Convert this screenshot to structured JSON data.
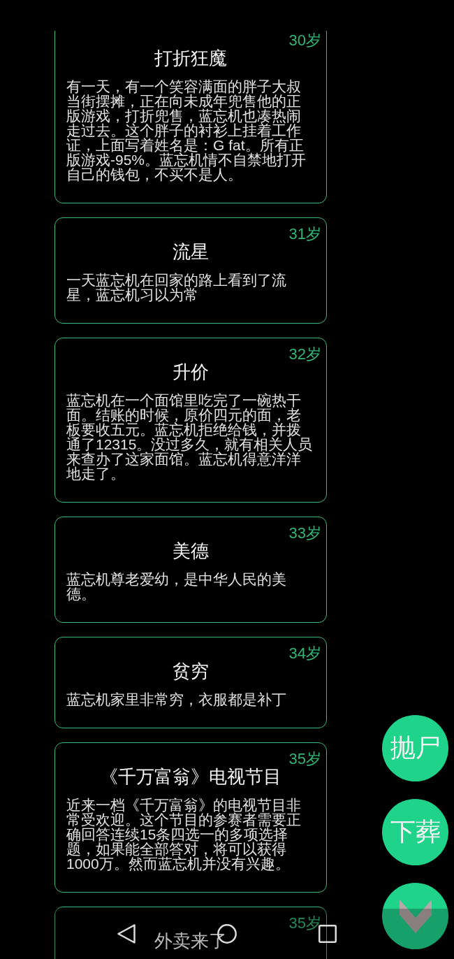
{
  "events": [
    {
      "age": "30岁",
      "title": "打折狂魔",
      "text": "有一天，有一个笑容满面的胖子大叔当街摆摊，正在向未成年兜售他的正版游戏，打折兜售，蓝忘机也凑热闹走过去。这个胖子的衬衫上挂着工作证，上面写着姓名是：G fat。所有正版游戏-95%。蓝忘机情不自禁地打开自己的钱包，不买不是人。"
    },
    {
      "age": "31岁",
      "title": "流星",
      "text": "一天蓝忘机在回家的路上看到了流星，蓝忘机习以为常"
    },
    {
      "age": "32岁",
      "title": "升价",
      "text": "蓝忘机在一个面馆里吃完了一碗热干面。结账的时候，原价四元的面，老板要收五元。蓝忘机拒绝给钱，并拨通了12315。没过多久，就有相关人员来查办了这家面馆。蓝忘机得意洋洋地走了。"
    },
    {
      "age": "33岁",
      "title": "美德",
      "text": "蓝忘机尊老爱幼，是中华人民的美德。"
    },
    {
      "age": "34岁",
      "title": "贫穷",
      "text": "蓝忘机家里非常穷，衣服都是补丁"
    },
    {
      "age": "35岁",
      "title": "《千万富翁》电视节目",
      "text": "近来一档《千万富翁》的电视节目非常受欢迎。这个节目的参赛者需要正确回答连续15条四选一的多项选择题，如果能全部答对，将可以获得1000万。然而蓝忘机并没有兴趣。"
    },
    {
      "age": "35岁",
      "title": "外卖来了"
    }
  ],
  "actions": [
    {
      "kind": "text",
      "label": "抛尸"
    },
    {
      "kind": "text",
      "label": "下葬"
    },
    {
      "kind": "scroll_down"
    }
  ],
  "nav_bar": {
    "buttons": [
      {
        "kind": "back"
      },
      {
        "kind": "home"
      },
      {
        "kind": "recents"
      }
    ]
  }
}
